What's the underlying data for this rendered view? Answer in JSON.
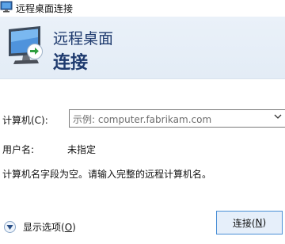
{
  "window": {
    "title": "远程桌面连接"
  },
  "banner": {
    "line1": "远程桌面",
    "line2": "连接"
  },
  "form": {
    "computer_label": "计算机(C):",
    "computer_placeholder": "示例: computer.fabrikam.com",
    "username_label": "用户名:",
    "username_value": "未指定",
    "message": "计算机名字段为空。请输入完整的远程计算机名。"
  },
  "footer": {
    "show_options_text": "显示选项(",
    "show_options_accel": "O",
    "show_options_end": ")",
    "connect_text": "连接(",
    "connect_accel": "N",
    "connect_end": ")"
  },
  "icons": {
    "title_icon": "remote-desktop-icon",
    "banner_icon": "remote-desktop-monitor-icon",
    "combo_arrow": "chevron-down-icon",
    "options_toggle": "chevron-down-circle-icon"
  },
  "colors": {
    "banner_background": "#e3ecf6",
    "banner_text": "#1e3a6e",
    "button_border": "#4a8fd6",
    "button_background": "#e6effa"
  }
}
